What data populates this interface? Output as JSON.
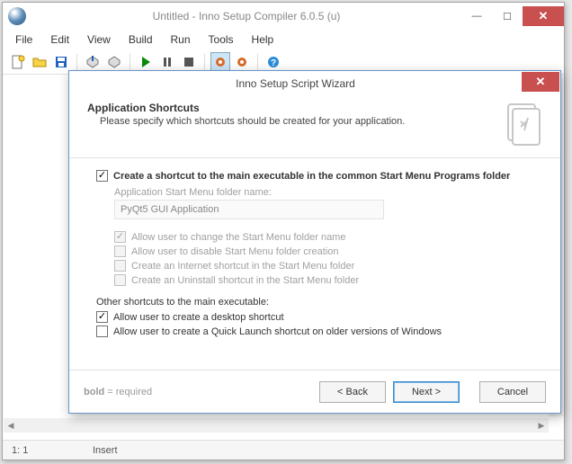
{
  "main": {
    "title": "Untitled - Inno Setup Compiler 6.0.5 (u)",
    "menu": [
      "File",
      "Edit",
      "View",
      "Build",
      "Run",
      "Tools",
      "Help"
    ],
    "status": {
      "pos": "1:   1",
      "mode": "Insert"
    }
  },
  "dialog": {
    "title": "Inno Setup Script Wizard",
    "heading": "Application Shortcuts",
    "subheading": "Please specify which shortcuts should be created for your application.",
    "create_main": "Create a shortcut to the main executable in the common Start Menu Programs folder",
    "folder_label": "Application Start Menu folder name:",
    "folder_value": "PyQt5 GUI Application",
    "opt_change": "Allow user to change the Start Menu folder name",
    "opt_disable": "Allow user to disable Start Menu folder creation",
    "opt_internet": "Create an Internet shortcut in the Start Menu folder",
    "opt_uninst": "Create an Uninstall shortcut in the Start Menu folder",
    "other_label": "Other shortcuts to the main executable:",
    "opt_desktop": "Allow user to create a desktop shortcut",
    "opt_quick": "Allow user to create a Quick Launch shortcut on older versions of Windows",
    "required": {
      "bold": "bold",
      "rest": " = required"
    },
    "buttons": {
      "back": "<  Back",
      "next": "Next  >",
      "cancel": "Cancel"
    }
  }
}
